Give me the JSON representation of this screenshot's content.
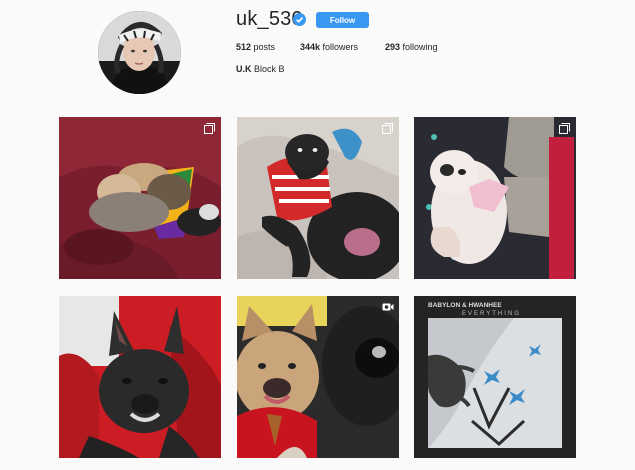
{
  "profile": {
    "username": "uk_530",
    "follow_label": "Follow",
    "posts_count": "512",
    "posts_label": "posts",
    "followers_count": "344k",
    "followers_label": "followers",
    "following_count": "293",
    "following_label": "following",
    "full_name": "U.K",
    "bio": "Block B",
    "verified_color": "#3897f0"
  },
  "posts": [
    {
      "badge": "multiple-icon"
    },
    {
      "badge": "multiple-icon"
    },
    {
      "badge": "multiple-icon"
    },
    {
      "badge": null
    },
    {
      "badge": "video-icon"
    },
    {
      "badge": null,
      "text_line1": "BABYLON & HWANHEE",
      "text_line2": "EVERYTHING"
    }
  ]
}
